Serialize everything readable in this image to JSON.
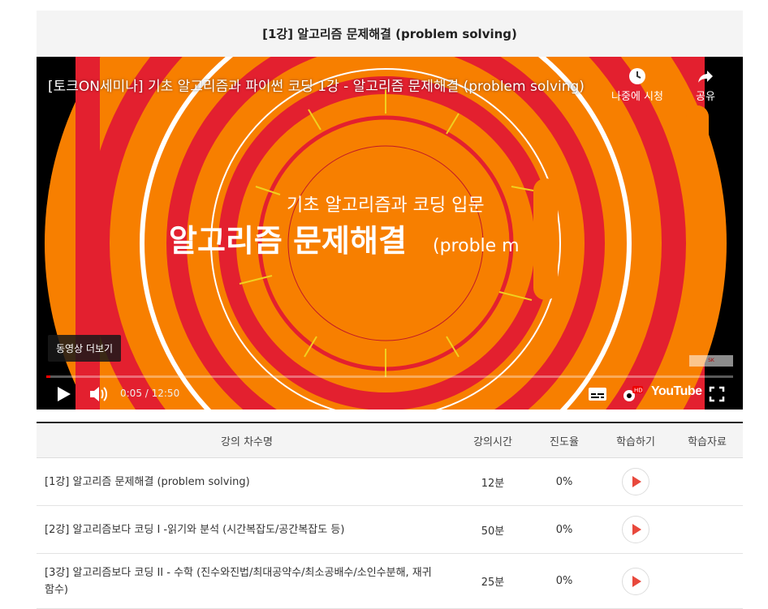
{
  "page_title": "[1강] 알고리즘 문제해결 (problem solving)",
  "video": {
    "title": "[토크ON세미나] 기초 알고리즘과 파이썬 코딩 1강 - 알고리즘 문제해결 (problem solving)",
    "watch_later_label": "나중에 시청",
    "share_label": "공유",
    "subtitle_text": "기초 알고리즘과 코딩 입문",
    "headline_text": "알고리즘 문제해결",
    "headline_tail": "(proble m",
    "more_videos_label": "동영상 더보기",
    "current_time": "0:05",
    "duration": "12:50",
    "time_display": "0:05 / 12:50",
    "progress": 0.0065,
    "hd_badge": "HD",
    "logo_text": "YouTube"
  },
  "table": {
    "headers": [
      "강의 차수명",
      "강의시간",
      "진도율",
      "학습하기",
      "학습자료"
    ],
    "rows": [
      {
        "name": "[1강] 알고리즘 문제해결 (problem solving)",
        "duration": "12분",
        "progress": "0%"
      },
      {
        "name": "[2강] 알고리즘보다 코딩 I -읽기와 분석 (시간복잡도/공간복잡도 등)",
        "duration": "50분",
        "progress": "0%"
      },
      {
        "name": "[3강] 알고리즘보다 코딩 II - 수학 (진수와진법/최대공약수/최소공배수/소인수분해, 재귀함수)",
        "duration": "25분",
        "progress": "0%"
      }
    ]
  },
  "colors": {
    "accent": "#e8483c",
    "video_orange": "#f77f00",
    "video_red": "#e3202f"
  }
}
